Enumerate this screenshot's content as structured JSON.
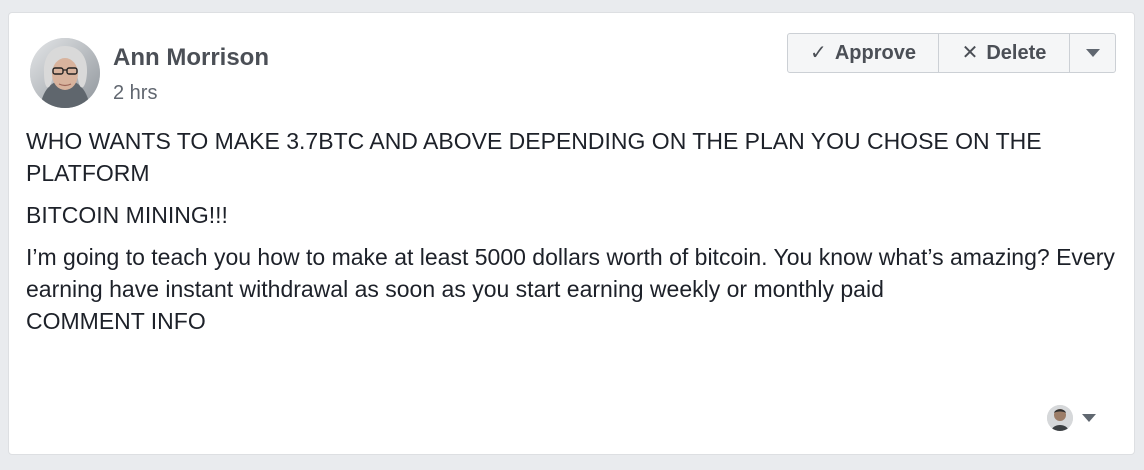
{
  "post": {
    "author": {
      "name": "Ann Morrison",
      "time": "2 hrs"
    },
    "actions": {
      "approve_label": "Approve",
      "delete_label": "Delete"
    },
    "lines": [
      "WHO WANTS TO MAKE 3.7BTC AND ABOVE DEPENDING ON THE PLAN YOU CHOSE ON THE PLATFORM",
      "BITCOIN MINING!!!",
      "I’m going to teach you how to make at least 5000 dollars worth of bitcoin. You know what’s amazing? Every earning have instant withdrawal as soon as you start earning weekly or monthly paid",
      "COMMENT INFO"
    ]
  },
  "icons": {
    "approve": "check-icon",
    "delete": "x-icon",
    "more": "caret-down-icon",
    "account": "avatar-icon"
  },
  "colors": {
    "page_background": "#e9ebee",
    "card_background": "#ffffff",
    "text": "#1d2129",
    "author_text": "#4b4f56",
    "button_text": "#4b4f56"
  }
}
